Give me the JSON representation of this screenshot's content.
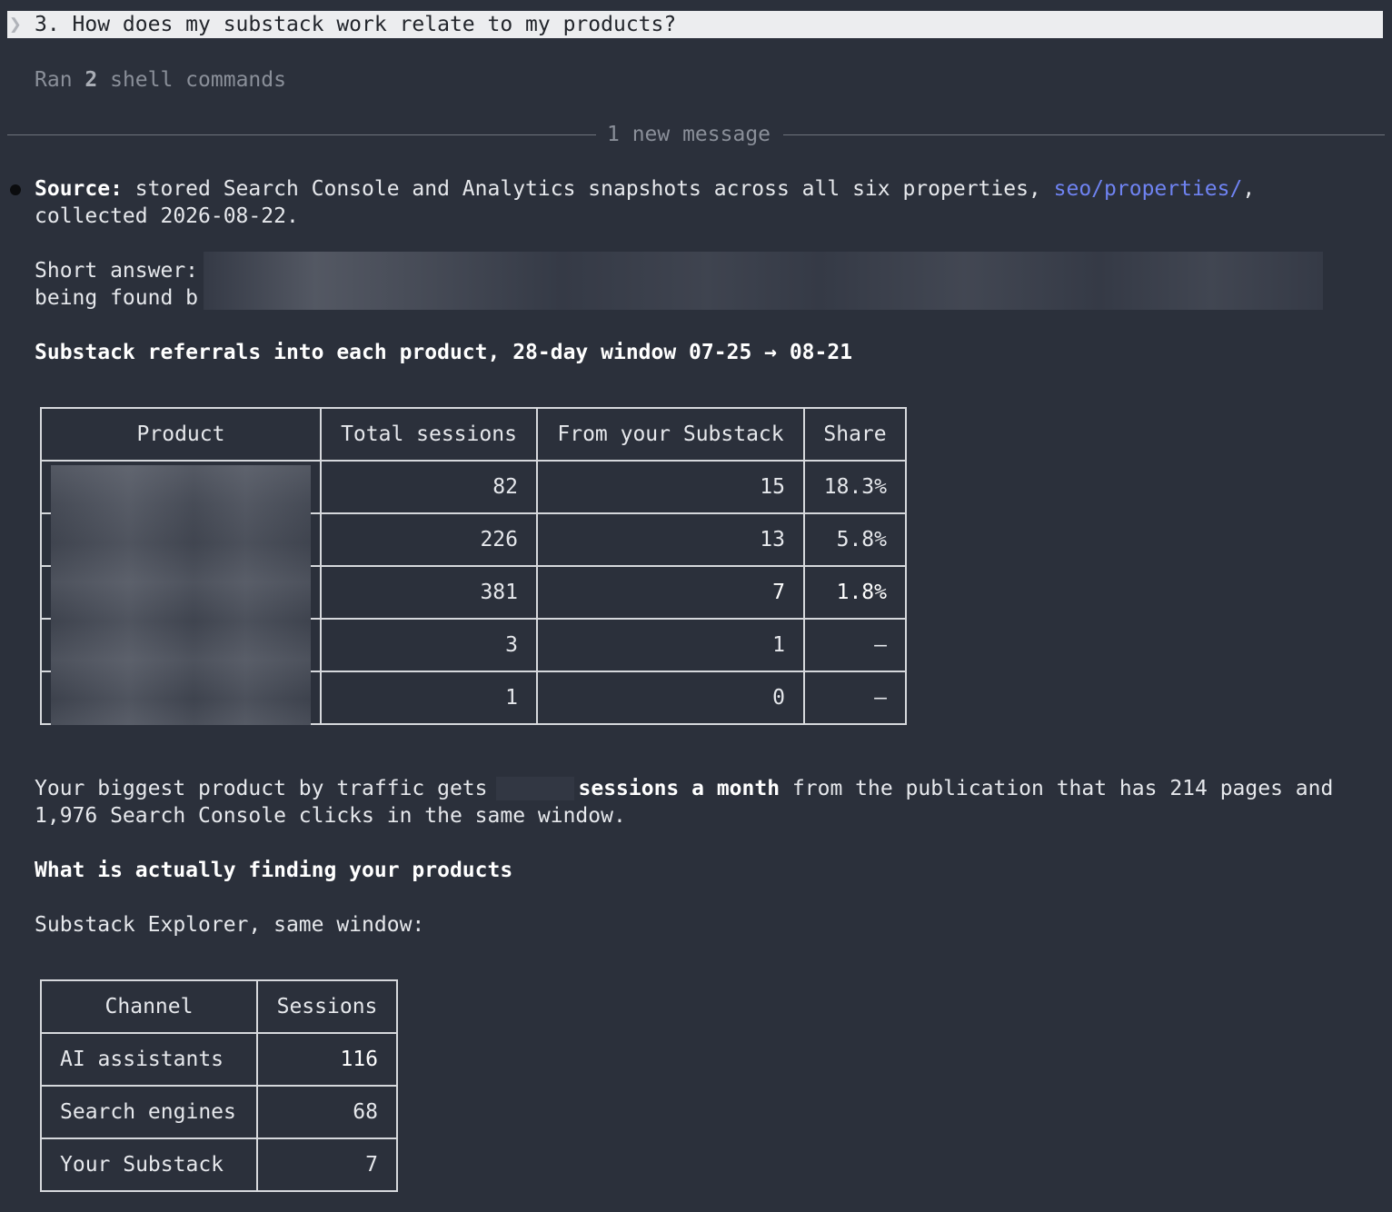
{
  "prompt": {
    "chevron": "❯",
    "text": "3. How does my substack work relate to my products?"
  },
  "status": {
    "ran_prefix": "Ran ",
    "ran_count": "2",
    "ran_suffix": " shell commands"
  },
  "divider": {
    "label": "1 new message"
  },
  "message": {
    "source_label": "Source:",
    "source_text": " stored Search Console and Analytics snapshots across all six properties, ",
    "source_link": "seo/properties/",
    "source_comma": ",",
    "source_line2": "collected 2026-08-22.",
    "short_answer_line1": "Short answer:",
    "short_answer_line2": "being found b",
    "heading1": "Substack referrals into each product, 28-day window 07-25 → 08-21",
    "para_prefix": "Your biggest product by traffic gets",
    "para_bold": "sessions a month",
    "para_suffix": " from the publication that has 214 pages and",
    "para_line2": "1,976 Search Console clicks in the same window.",
    "heading2": "What is actually finding your products",
    "explorer_line": "Substack Explorer, same window:"
  },
  "products_table": {
    "headers": [
      "Product",
      "Total sessions",
      "From your Substack",
      "Share"
    ],
    "rows": [
      {
        "total": "82",
        "from": "15",
        "share": "18.3%"
      },
      {
        "total": "226",
        "from": "13",
        "share": "5.8%"
      },
      {
        "total": "381",
        "from": "7",
        "share": "1.8%"
      },
      {
        "total": "3",
        "from": "1",
        "share": "–"
      },
      {
        "total": "1",
        "from": "0",
        "share": "–"
      }
    ]
  },
  "channels_table": {
    "headers": [
      "Channel",
      "Sessions"
    ],
    "rows": [
      {
        "channel": "AI assistants",
        "sessions": "116"
      },
      {
        "channel": "Search engines",
        "sessions": "68"
      },
      {
        "channel": "Your Substack",
        "sessions": "7"
      }
    ]
  }
}
